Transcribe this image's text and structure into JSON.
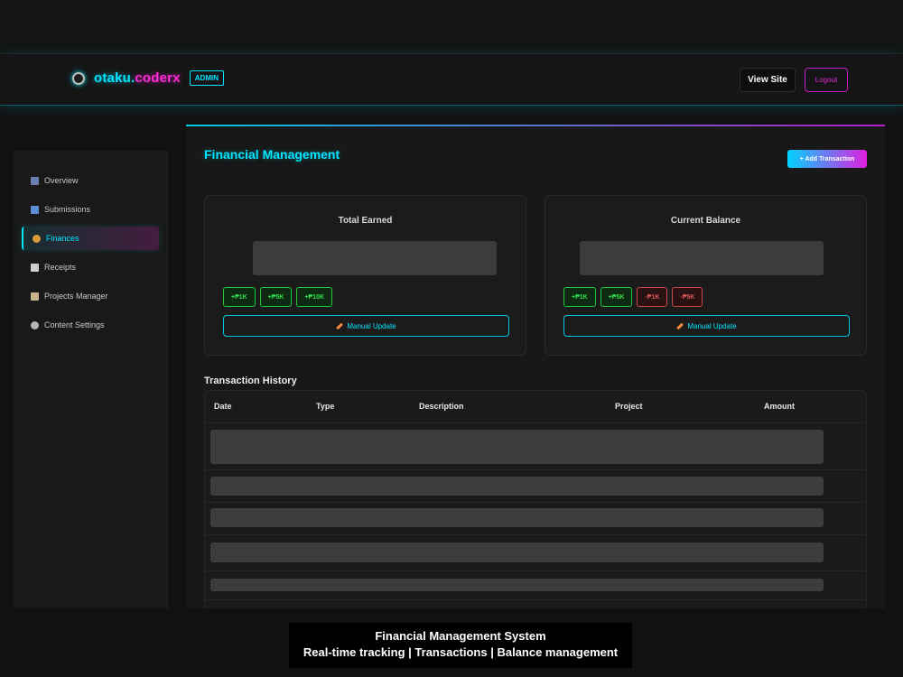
{
  "header": {
    "brand_part1": "otaku.",
    "brand_part2": "coderx",
    "admin_badge": "ADMIN",
    "view_site_label": "View Site",
    "logout_label": "Logout"
  },
  "sidebar": {
    "items": [
      {
        "label": "Overview",
        "icon": "chart-icon"
      },
      {
        "label": "Submissions",
        "icon": "inbox-icon"
      },
      {
        "label": "Finances",
        "icon": "money-bag-icon",
        "active": true
      },
      {
        "label": "Receipts",
        "icon": "receipt-icon"
      },
      {
        "label": "Projects Manager",
        "icon": "clipboard-icon"
      },
      {
        "label": "Content Settings",
        "icon": "gear-icon"
      }
    ]
  },
  "main": {
    "title": "Financial Management",
    "add_transaction_label": "+ Add Transaction",
    "cards": [
      {
        "title": "Total Earned",
        "quick_buttons": [
          "+₱1K",
          "+₱5K",
          "+₱10K"
        ],
        "manual_update_label": "Manual Update"
      },
      {
        "title": "Current Balance",
        "quick_buttons": [
          "+₱1K",
          "+₱5K",
          "-₱1K",
          "-₱5K"
        ],
        "manual_update_label": "Manual Update"
      }
    ],
    "history_title": "Transaction History",
    "table_headers": [
      "Date",
      "Type",
      "Description",
      "Project",
      "Amount"
    ]
  },
  "caption": {
    "line1": "Financial Management System",
    "line2": "Real-time tracking | Transactions | Balance management"
  },
  "colors": {
    "accent_cyan": "#00e5ff",
    "accent_magenta": "#ff2bd6",
    "positive_green": "#32e04e",
    "negative_red": "#e05a5a"
  }
}
